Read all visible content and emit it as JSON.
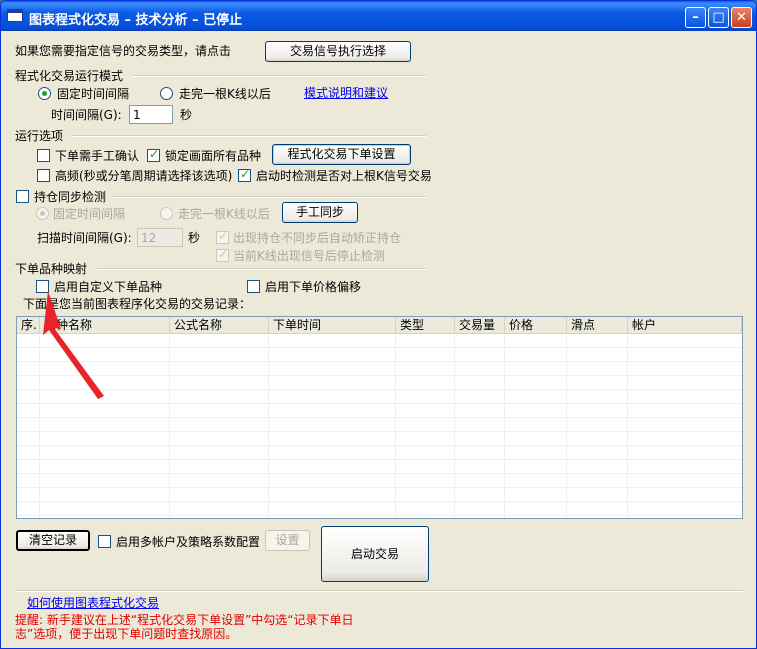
{
  "window": {
    "title": "图表程式化交易 – 技术分析 – 已停止"
  },
  "top": {
    "prompt": "如果您需要指定信号的交易类型，请点击",
    "signal_button": "交易信号执行选择"
  },
  "run_mode": {
    "heading": "程式化交易运行模式",
    "fixed_interval": "固定时间间隔",
    "after_kline": "走完一根K线以后",
    "help_link": "模式说明和建议",
    "interval_label": "时间间隔(G):",
    "interval_value": "1",
    "interval_unit": "秒"
  },
  "run_options": {
    "heading": "运行选项",
    "manual_confirm": "下单需手工确认",
    "lock_all": "锁定画面所有品种",
    "order_settings_button": "程式化交易下单设置",
    "high_freq": "高频(秒或分笔周期请选择该选项)",
    "check_last_signal": "启动时检测是否对上根K信号交易"
  },
  "position_sync": {
    "heading": "持仓同步检测",
    "fixed_interval": "固定时间间隔",
    "after_kline": "走完一根K线以后",
    "manual_sync_button": "手工同步",
    "scan_label": "扫描时间间隔(G):",
    "scan_value": "12",
    "scan_unit": "秒",
    "auto_correct": "出现持仓不同步后自动矫正持仓",
    "stop_detect": "当前K线出现信号后停止检测"
  },
  "mapping": {
    "heading": "下单品种映射",
    "custom_symbol": "启用自定义下单品种",
    "price_offset": "启用下单价格偏移",
    "records_caption": "下面是您当前图表程序化交易的交易记录："
  },
  "table": {
    "columns": [
      "序.",
      "品种名称",
      "公式名称",
      "下单时间",
      "类型",
      "交易量",
      "价格",
      "滑点",
      "帐户"
    ]
  },
  "bottom": {
    "clear_button": "清空记录",
    "multi_account": "启用多帐户及策略系数配置",
    "settings_button": "设置",
    "start_button": "启动交易",
    "help_link": "如何使用图表程式化交易",
    "note": "提醒: 新手建议在上述“程式化交易下单设置”中勾选“记录下单日志”选项，便于出现下单问题时查找原因。"
  },
  "colors": {
    "titlebar": "#0b59e4",
    "dialog_bg": "#ece9d8",
    "annotation_arrow": "#e8232a",
    "note_text": "#e00000"
  }
}
